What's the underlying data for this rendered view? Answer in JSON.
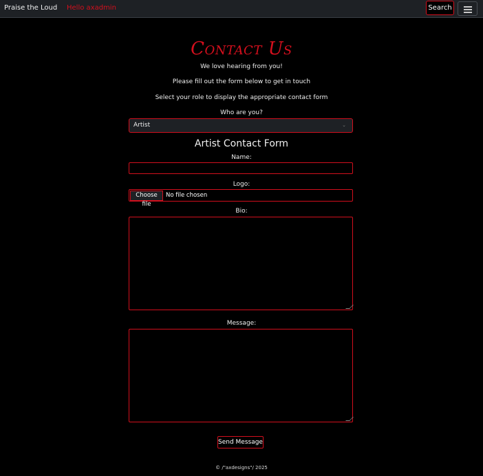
{
  "navbar": {
    "brand": "Praise the Loud",
    "greeting": "Hello axadmin",
    "search_label": "Search",
    "menu_icon": "hamburger-icon"
  },
  "page": {
    "title": "Contact Us",
    "intro1": "We love hearing from you!",
    "intro2": "Please fill out the form below to get in touch",
    "intro3": "Select your role to display the appropriate contact form"
  },
  "role": {
    "label": "Who are you?",
    "selected": "Artist"
  },
  "form": {
    "heading": "Artist Contact Form",
    "name_label": "Name:",
    "name_value": "",
    "logo_label": "Logo:",
    "file_button": "Choose file",
    "file_status": "No file chosen",
    "bio_label": "Bio:",
    "message_label": "Message:",
    "send_label": "Send Message"
  },
  "footer": {
    "text": "© /\"axdesigns\"/ 2025"
  },
  "colors": {
    "accent": "#d40f1d",
    "background": "#000000",
    "navbar": "#1e2125"
  }
}
